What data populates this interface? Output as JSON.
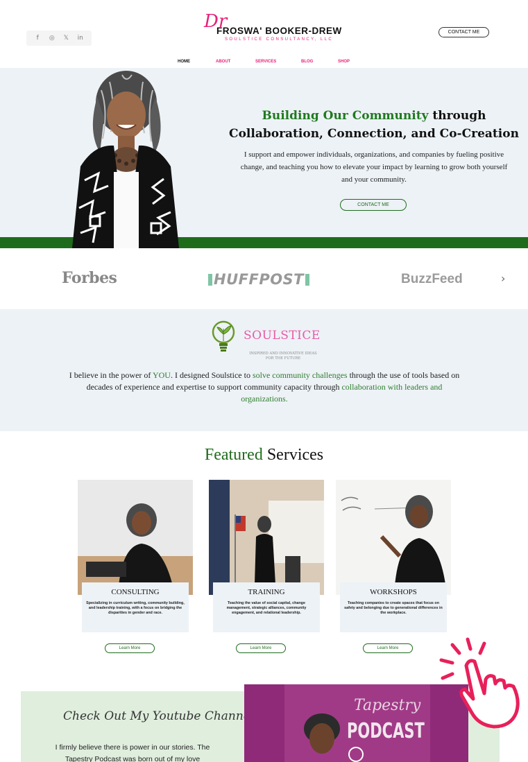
{
  "header": {
    "social_icons": [
      "facebook-icon",
      "instagram-icon",
      "x-icon",
      "linkedin-icon"
    ],
    "social_glyphs": [
      "f",
      "◎",
      "𝕏",
      "in"
    ],
    "logo_dr": "Dr",
    "logo_name": "FROSWA' BOOKER-DREW",
    "logo_sub": "SOULSTICE CONSULTANCY, LLC",
    "contact_label": "CONTACT ME",
    "nav": [
      {
        "label": "HOME",
        "active": true
      },
      {
        "label": "ABOUT",
        "active": false
      },
      {
        "label": "SERVICES",
        "active": false
      },
      {
        "label": "BLOG",
        "active": false
      },
      {
        "label": "SHOP",
        "active": false
      }
    ]
  },
  "hero": {
    "title_green": "Building Our Community",
    "title_rest": " through",
    "title_line2": "Collaboration, Connection, and Co-Creation",
    "body": "I support and empower individuals, organizations, and companies by fueling positive change, and teaching you how to elevate your impact by learning to grow both yourself and your community.",
    "button": "CONTACT ME"
  },
  "press": {
    "logos": [
      "Forbes",
      "HUFFPOST",
      "BuzzFeed"
    ],
    "next_glyph": "›"
  },
  "soulstice": {
    "logo_word": "SOULSTICE",
    "logo_tagline": "INSPIRED AND INNOVATIVE IDEAS FOR THE FUTURE",
    "text_1": "I believe in the power of ",
    "text_you": "YOU",
    "text_2": ". I designed Soulstice to ",
    "text_challenges": "solve community challenges",
    "text_3": " through the use of tools based on decades of experience and expertise to support community capacity through ",
    "text_collab": "collaboration with leaders and organizations."
  },
  "featured": {
    "title_green": "Featured",
    "title_rest": " Services",
    "cards": [
      {
        "title": "CONSULTING",
        "desc": "Specializing in curriculum writing, community building, and leadership training, with a focus on bridging the disparities in gender and race.",
        "button": "Learn More"
      },
      {
        "title": "TRAINING",
        "desc": "Teaching the value of social capital, change management, strategic alliances, community engagement, and relational leadership.",
        "button": "Learn More"
      },
      {
        "title": "WORKSHOPS",
        "desc": "Teaching companies to create spaces that focus on safety and belonging due to generational differences in the workplace.",
        "button": "Learn More"
      }
    ]
  },
  "youtube": {
    "heading": "Check Out My Youtube Channel",
    "text": "I firmly believe there is power in our stories. The Tapestry Podcast was born out of my love",
    "podcast_title_1": "Tapestry",
    "podcast_title_2": "PODCAST"
  },
  "colors": {
    "accent_pink": "#e8207a",
    "brand_green": "#1f6b1c",
    "panel_bg": "#edf2f6",
    "podcast_purple": "#8f2a78"
  }
}
